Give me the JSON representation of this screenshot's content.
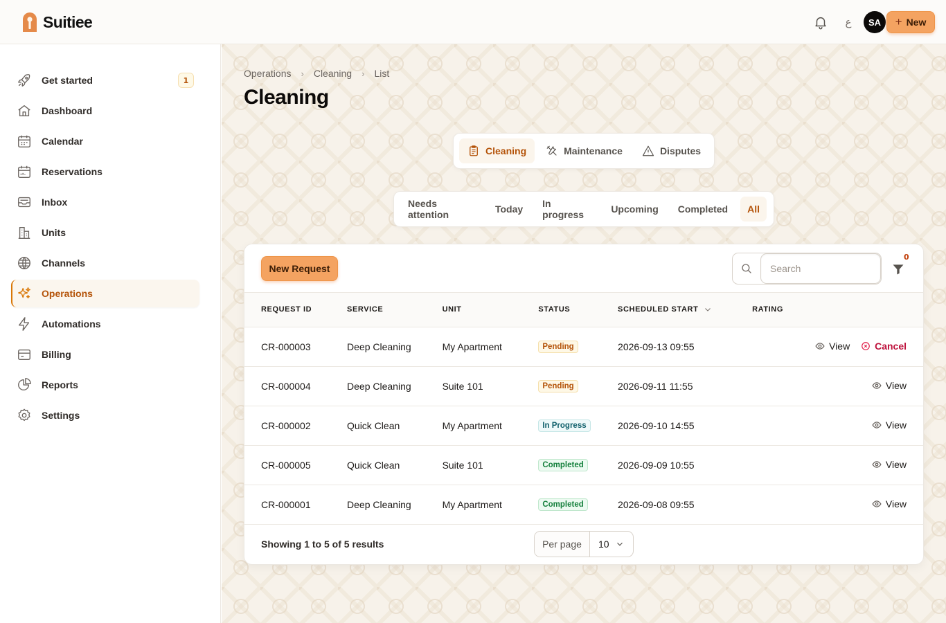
{
  "app": {
    "name": "Suitiee"
  },
  "topbar": {
    "lang_glyph": "ع",
    "avatar_initials": "SA",
    "new_label": "New"
  },
  "sidebar": {
    "items": [
      {
        "key": "get-started",
        "label": "Get started",
        "icon": "rocket-icon",
        "badge": "1"
      },
      {
        "key": "dashboard",
        "label": "Dashboard",
        "icon": "home-icon"
      },
      {
        "key": "calendar",
        "label": "Calendar",
        "icon": "calendar-icon"
      },
      {
        "key": "reservations",
        "label": "Reservations",
        "icon": "calendar-check-icon"
      },
      {
        "key": "inbox",
        "label": "Inbox",
        "icon": "inbox-icon"
      },
      {
        "key": "units",
        "label": "Units",
        "icon": "building-icon"
      },
      {
        "key": "channels",
        "label": "Channels",
        "icon": "globe-icon"
      },
      {
        "key": "operations",
        "label": "Operations",
        "icon": "sparkles-icon",
        "active": true
      },
      {
        "key": "automations",
        "label": "Automations",
        "icon": "bolt-icon"
      },
      {
        "key": "billing",
        "label": "Billing",
        "icon": "wallet-icon"
      },
      {
        "key": "reports",
        "label": "Reports",
        "icon": "pie-chart-icon"
      },
      {
        "key": "settings",
        "label": "Settings",
        "icon": "gear-icon"
      }
    ]
  },
  "breadcrumb": [
    "Operations",
    "Cleaning",
    "List"
  ],
  "page": {
    "title": "Cleaning"
  },
  "category_tabs": [
    {
      "label": "Cleaning",
      "icon": "clipboard-icon",
      "active": true
    },
    {
      "label": "Maintenance",
      "icon": "wrench-icon"
    },
    {
      "label": "Disputes",
      "icon": "warning-icon"
    }
  ],
  "status_tabs": [
    {
      "label": "Needs attention"
    },
    {
      "label": "Today"
    },
    {
      "label": "In progress"
    },
    {
      "label": "Upcoming"
    },
    {
      "label": "Completed"
    },
    {
      "label": "All",
      "active": true
    }
  ],
  "toolbar": {
    "new_request_label": "New Request",
    "search_placeholder": "Search",
    "filter_count": "0"
  },
  "table": {
    "headers": {
      "request_id": "REQUEST ID",
      "service": "SERVICE",
      "unit": "UNIT",
      "status": "STATUS",
      "scheduled_start": "SCHEDULED START",
      "rating": "RATING"
    },
    "rows": [
      {
        "id": "CR-000003",
        "service": "Deep Cleaning",
        "unit": "My Apartment",
        "status": "Pending",
        "status_kind": "pending",
        "scheduled": "2026-09-13 09:55",
        "rating": "",
        "view": "View",
        "cancel": "Cancel"
      },
      {
        "id": "CR-000004",
        "service": "Deep Cleaning",
        "unit": "Suite 101",
        "status": "Pending",
        "status_kind": "pending",
        "scheduled": "2026-09-11 11:55",
        "rating": "",
        "view": "View"
      },
      {
        "id": "CR-000002",
        "service": "Quick Clean",
        "unit": "My Apartment",
        "status": "In Progress",
        "status_kind": "inprogress",
        "scheduled": "2026-09-10 14:55",
        "rating": "",
        "view": "View"
      },
      {
        "id": "CR-000005",
        "service": "Quick Clean",
        "unit": "Suite 101",
        "status": "Completed",
        "status_kind": "completed",
        "scheduled": "2026-09-09 10:55",
        "rating": "",
        "view": "View"
      },
      {
        "id": "CR-000001",
        "service": "Deep Cleaning",
        "unit": "My Apartment",
        "status": "Completed",
        "status_kind": "completed",
        "scheduled": "2026-09-08 09:55",
        "rating": "",
        "view": "View"
      }
    ]
  },
  "footer": {
    "results_text": "Showing 1 to 5 of 5 results",
    "per_page_label": "Per page",
    "per_page_value": "10"
  },
  "colors": {
    "accent": "#f4a361",
    "accent_text": "#b45309",
    "cancel": "#be123c"
  }
}
